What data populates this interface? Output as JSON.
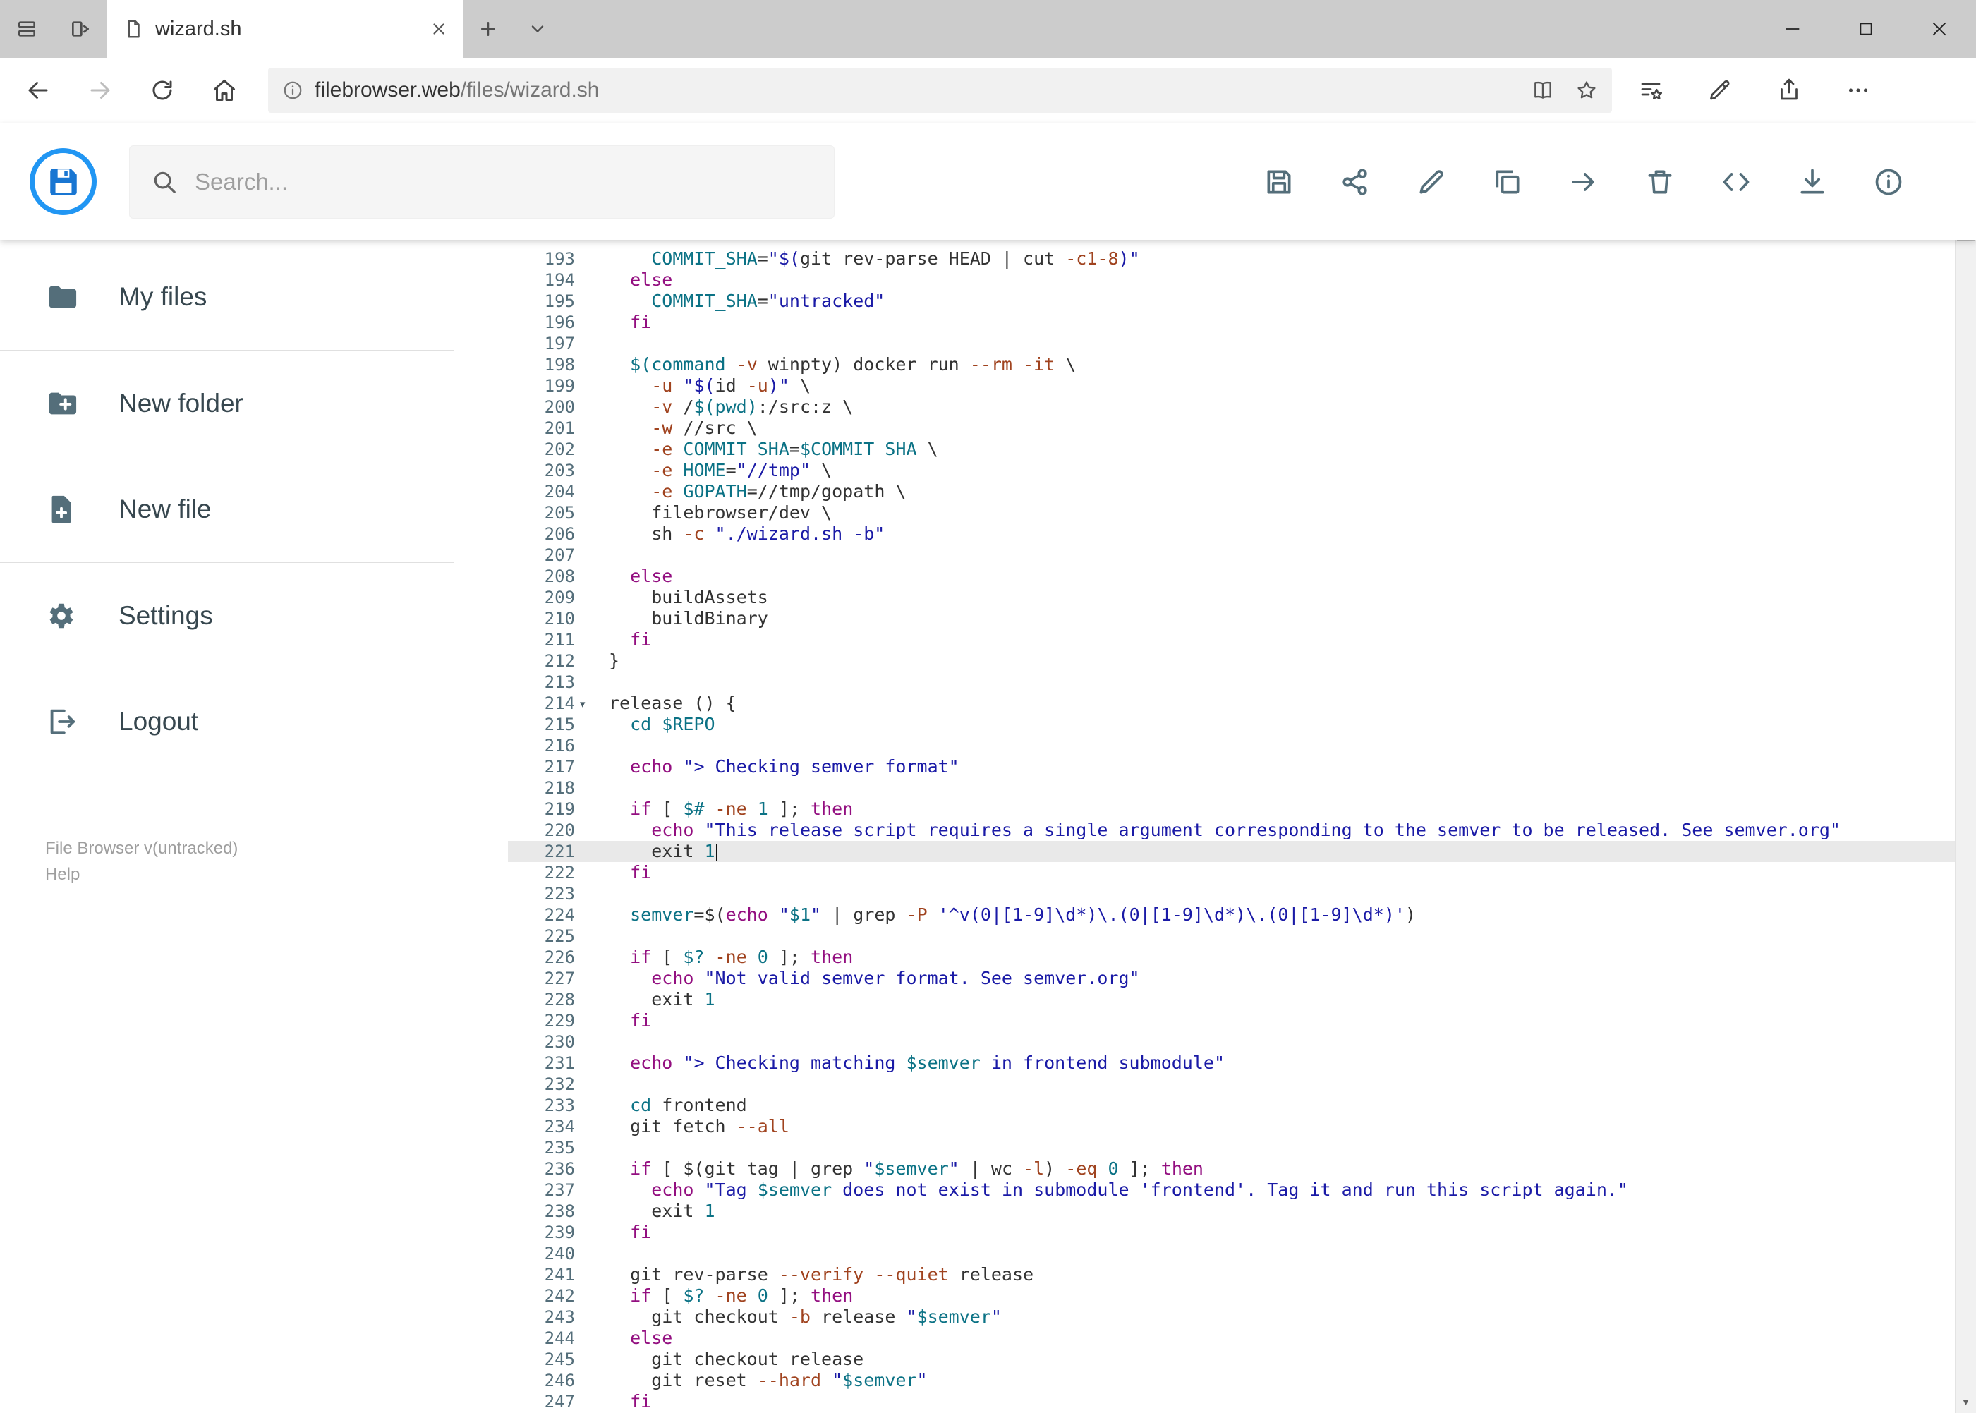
{
  "colors": {
    "accent_blue": "#2196f3",
    "toolbar_icon": "#546e7a",
    "keyword": "#930f80",
    "string": "#1a1aa6",
    "variable": "#0b7285",
    "flag": "#a0431f",
    "active_line_bg": "#e9e9e9",
    "tabstrip_bg": "#cccccc"
  },
  "browser": {
    "tab_title": "wizard.sh",
    "url_host": "filebrowser.web",
    "url_path": "/files/wizard.sh",
    "window_controls": [
      "minimize",
      "maximize",
      "close"
    ],
    "left_icons": [
      "tab-preview-icon",
      "set-tabs-aside-icon"
    ],
    "nav_icons": [
      "back",
      "forward",
      "refresh",
      "home"
    ],
    "addressbar_icons": [
      "info-circle",
      "reading-view",
      "favorite-star"
    ],
    "right_icons": [
      "favorites-hub",
      "ink-notes",
      "share",
      "more-ellipsis"
    ]
  },
  "app": {
    "search": {
      "placeholder": "Search..."
    },
    "toolbar": {
      "icons": [
        "save",
        "share",
        "rename",
        "copy",
        "move",
        "delete",
        "code-view",
        "download",
        "info"
      ]
    },
    "sidebar": {
      "items": [
        {
          "label": "My files",
          "icon": "folder-icon"
        },
        {
          "label": "New folder",
          "icon": "folder-plus-icon"
        },
        {
          "label": "New file",
          "icon": "file-plus-icon"
        },
        {
          "label": "Settings",
          "icon": "gear-icon"
        },
        {
          "label": "Logout",
          "icon": "logout-icon"
        }
      ],
      "footer": {
        "version": "File Browser v(untracked)",
        "help": "Help"
      }
    }
  },
  "editor": {
    "file": "wizard.sh",
    "active_line": 221,
    "first_line": 193,
    "last_line": 247,
    "lines": [
      {
        "n": 193,
        "t": [
          [
            "    ",
            "p"
          ],
          [
            "COMMIT_SHA",
            "v"
          ],
          [
            "=",
            "p"
          ],
          [
            "\"$(",
            "s"
          ],
          [
            "git rev-parse HEAD | cut ",
            "p"
          ],
          [
            "-c1-8",
            "f"
          ],
          [
            ")\"",
            "s"
          ]
        ]
      },
      {
        "n": 194,
        "t": [
          [
            "  ",
            "p"
          ],
          [
            "else",
            "k"
          ]
        ]
      },
      {
        "n": 195,
        "t": [
          [
            "    ",
            "p"
          ],
          [
            "COMMIT_SHA",
            "v"
          ],
          [
            "=",
            "p"
          ],
          [
            "\"untracked\"",
            "s"
          ]
        ]
      },
      {
        "n": 196,
        "t": [
          [
            "  ",
            "p"
          ],
          [
            "fi",
            "k"
          ]
        ]
      },
      {
        "n": 197,
        "t": []
      },
      {
        "n": 198,
        "t": [
          [
            "  ",
            "p"
          ],
          [
            "$(command",
            "b"
          ],
          [
            " ",
            "p"
          ],
          [
            "-v",
            "f"
          ],
          [
            " winpty) docker run ",
            "p"
          ],
          [
            "--rm",
            "f"
          ],
          [
            " ",
            "p"
          ],
          [
            "-it",
            "f"
          ],
          [
            " \\",
            "p"
          ]
        ]
      },
      {
        "n": 199,
        "t": [
          [
            "    ",
            "p"
          ],
          [
            "-u",
            "f"
          ],
          [
            " ",
            "p"
          ],
          [
            "\"$(",
            "s"
          ],
          [
            "id ",
            "p"
          ],
          [
            "-u",
            "f"
          ],
          [
            ")\"",
            "s"
          ],
          [
            " \\",
            "p"
          ]
        ]
      },
      {
        "n": 200,
        "t": [
          [
            "    ",
            "p"
          ],
          [
            "-v",
            "f"
          ],
          [
            " /",
            "p"
          ],
          [
            "$(pwd)",
            "v"
          ],
          [
            ":/src:z \\",
            "p"
          ]
        ]
      },
      {
        "n": 201,
        "t": [
          [
            "    ",
            "p"
          ],
          [
            "-w",
            "f"
          ],
          [
            " //src \\",
            "p"
          ]
        ]
      },
      {
        "n": 202,
        "t": [
          [
            "    ",
            "p"
          ],
          [
            "-e",
            "f"
          ],
          [
            " ",
            "p"
          ],
          [
            "COMMIT_SHA",
            "v"
          ],
          [
            "=",
            "p"
          ],
          [
            "$COMMIT_SHA",
            "v"
          ],
          [
            " \\",
            "p"
          ]
        ]
      },
      {
        "n": 203,
        "t": [
          [
            "    ",
            "p"
          ],
          [
            "-e",
            "f"
          ],
          [
            " ",
            "p"
          ],
          [
            "HOME",
            "v"
          ],
          [
            "=",
            "p"
          ],
          [
            "\"//tmp\"",
            "s"
          ],
          [
            " \\",
            "p"
          ]
        ]
      },
      {
        "n": 204,
        "t": [
          [
            "    ",
            "p"
          ],
          [
            "-e",
            "f"
          ],
          [
            " ",
            "p"
          ],
          [
            "GOPATH",
            "v"
          ],
          [
            "=//tmp/gopath \\",
            "p"
          ]
        ]
      },
      {
        "n": 205,
        "t": [
          [
            "    filebrowser/dev \\",
            "p"
          ]
        ]
      },
      {
        "n": 206,
        "t": [
          [
            "    sh ",
            "p"
          ],
          [
            "-c",
            "f"
          ],
          [
            " ",
            "p"
          ],
          [
            "\"./wizard.sh -b\"",
            "s"
          ]
        ]
      },
      {
        "n": 207,
        "t": []
      },
      {
        "n": 208,
        "t": [
          [
            "  ",
            "p"
          ],
          [
            "else",
            "k"
          ]
        ]
      },
      {
        "n": 209,
        "t": [
          [
            "    buildAssets",
            "p"
          ]
        ]
      },
      {
        "n": 210,
        "t": [
          [
            "    buildBinary",
            "p"
          ]
        ]
      },
      {
        "n": 211,
        "t": [
          [
            "  ",
            "p"
          ],
          [
            "fi",
            "k"
          ]
        ]
      },
      {
        "n": 212,
        "t": [
          [
            "}",
            "p"
          ]
        ]
      },
      {
        "n": 213,
        "t": []
      },
      {
        "n": 214,
        "fold": true,
        "t": [
          [
            "release () {",
            "p"
          ]
        ]
      },
      {
        "n": 215,
        "t": [
          [
            "  ",
            "p"
          ],
          [
            "cd",
            "b"
          ],
          [
            " ",
            "p"
          ],
          [
            "$REPO",
            "v"
          ]
        ]
      },
      {
        "n": 216,
        "t": []
      },
      {
        "n": 217,
        "t": [
          [
            "  ",
            "p"
          ],
          [
            "echo",
            "k"
          ],
          [
            " ",
            "p"
          ],
          [
            "\"> Checking semver format\"",
            "s"
          ]
        ]
      },
      {
        "n": 218,
        "t": []
      },
      {
        "n": 219,
        "t": [
          [
            "  ",
            "p"
          ],
          [
            "if",
            "k"
          ],
          [
            " [ ",
            "p"
          ],
          [
            "$#",
            "v"
          ],
          [
            " ",
            "p"
          ],
          [
            "-ne",
            "f"
          ],
          [
            " ",
            "p"
          ],
          [
            "1",
            "n"
          ],
          [
            " ]; ",
            "p"
          ],
          [
            "then",
            "k"
          ]
        ]
      },
      {
        "n": 220,
        "t": [
          [
            "    ",
            "p"
          ],
          [
            "echo",
            "k"
          ],
          [
            " ",
            "p"
          ],
          [
            "\"This release script requires a single argument corresponding to the semver to be released. See semver.org\"",
            "s"
          ]
        ]
      },
      {
        "n": 221,
        "cursor": true,
        "t": [
          [
            "    exit ",
            "p"
          ],
          [
            "1",
            "n"
          ]
        ]
      },
      {
        "n": 222,
        "t": [
          [
            "  ",
            "p"
          ],
          [
            "fi",
            "k"
          ]
        ]
      },
      {
        "n": 223,
        "t": []
      },
      {
        "n": 224,
        "t": [
          [
            "  ",
            "p"
          ],
          [
            "semver",
            "v"
          ],
          [
            "=$(",
            "p"
          ],
          [
            "echo",
            "k"
          ],
          [
            " ",
            "p"
          ],
          [
            "\"",
            "s"
          ],
          [
            "$1",
            "v"
          ],
          [
            "\"",
            "s"
          ],
          [
            " | grep ",
            "p"
          ],
          [
            "-P",
            "f"
          ],
          [
            " ",
            "p"
          ],
          [
            "'^v(0|[1-9]\\d*)\\.(0|[1-9]\\d*)\\.(0|[1-9]\\d*)'",
            "s"
          ],
          [
            ")",
            "p"
          ]
        ]
      },
      {
        "n": 225,
        "t": []
      },
      {
        "n": 226,
        "t": [
          [
            "  ",
            "p"
          ],
          [
            "if",
            "k"
          ],
          [
            " [ ",
            "p"
          ],
          [
            "$?",
            "v"
          ],
          [
            " ",
            "p"
          ],
          [
            "-ne",
            "f"
          ],
          [
            " ",
            "p"
          ],
          [
            "0",
            "n"
          ],
          [
            " ]; ",
            "p"
          ],
          [
            "then",
            "k"
          ]
        ]
      },
      {
        "n": 227,
        "t": [
          [
            "    ",
            "p"
          ],
          [
            "echo",
            "k"
          ],
          [
            " ",
            "p"
          ],
          [
            "\"Not valid semver format. See semver.org\"",
            "s"
          ]
        ]
      },
      {
        "n": 228,
        "t": [
          [
            "    exit ",
            "p"
          ],
          [
            "1",
            "n"
          ]
        ]
      },
      {
        "n": 229,
        "t": [
          [
            "  ",
            "p"
          ],
          [
            "fi",
            "k"
          ]
        ]
      },
      {
        "n": 230,
        "t": []
      },
      {
        "n": 231,
        "t": [
          [
            "  ",
            "p"
          ],
          [
            "echo",
            "k"
          ],
          [
            " ",
            "p"
          ],
          [
            "\"> Checking matching ",
            "s"
          ],
          [
            "$semver",
            "v"
          ],
          [
            " in frontend submodule\"",
            "s"
          ]
        ]
      },
      {
        "n": 232,
        "t": []
      },
      {
        "n": 233,
        "t": [
          [
            "  ",
            "p"
          ],
          [
            "cd",
            "b"
          ],
          [
            " frontend",
            "p"
          ]
        ]
      },
      {
        "n": 234,
        "t": [
          [
            "  git fetch ",
            "p"
          ],
          [
            "--all",
            "f"
          ]
        ]
      },
      {
        "n": 235,
        "t": []
      },
      {
        "n": 236,
        "t": [
          [
            "  ",
            "p"
          ],
          [
            "if",
            "k"
          ],
          [
            " [ $(git tag | grep ",
            "p"
          ],
          [
            "\"",
            "s"
          ],
          [
            "$semver",
            "v"
          ],
          [
            "\"",
            "s"
          ],
          [
            " | wc ",
            "p"
          ],
          [
            "-l",
            "f"
          ],
          [
            ") ",
            "p"
          ],
          [
            "-eq",
            "f"
          ],
          [
            " ",
            "p"
          ],
          [
            "0",
            "n"
          ],
          [
            " ]; ",
            "p"
          ],
          [
            "then",
            "k"
          ]
        ]
      },
      {
        "n": 237,
        "t": [
          [
            "    ",
            "p"
          ],
          [
            "echo",
            "k"
          ],
          [
            " ",
            "p"
          ],
          [
            "\"Tag ",
            "s"
          ],
          [
            "$semver",
            "v"
          ],
          [
            " does not exist in submodule 'frontend'. Tag it and run this script again.\"",
            "s"
          ]
        ]
      },
      {
        "n": 238,
        "t": [
          [
            "    exit ",
            "p"
          ],
          [
            "1",
            "n"
          ]
        ]
      },
      {
        "n": 239,
        "t": [
          [
            "  ",
            "p"
          ],
          [
            "fi",
            "k"
          ]
        ]
      },
      {
        "n": 240,
        "t": []
      },
      {
        "n": 241,
        "t": [
          [
            "  git rev-parse ",
            "p"
          ],
          [
            "--verify",
            "f"
          ],
          [
            " ",
            "p"
          ],
          [
            "--quiet",
            "f"
          ],
          [
            " release",
            "p"
          ]
        ]
      },
      {
        "n": 242,
        "t": [
          [
            "  ",
            "p"
          ],
          [
            "if",
            "k"
          ],
          [
            " [ ",
            "p"
          ],
          [
            "$?",
            "v"
          ],
          [
            " ",
            "p"
          ],
          [
            "-ne",
            "f"
          ],
          [
            " ",
            "p"
          ],
          [
            "0",
            "n"
          ],
          [
            " ]; ",
            "p"
          ],
          [
            "then",
            "k"
          ]
        ]
      },
      {
        "n": 243,
        "t": [
          [
            "    git checkout ",
            "p"
          ],
          [
            "-b",
            "f"
          ],
          [
            " release ",
            "p"
          ],
          [
            "\"",
            "s"
          ],
          [
            "$semver",
            "v"
          ],
          [
            "\"",
            "s"
          ]
        ]
      },
      {
        "n": 244,
        "t": [
          [
            "  ",
            "p"
          ],
          [
            "else",
            "k"
          ]
        ]
      },
      {
        "n": 245,
        "t": [
          [
            "    git checkout release",
            "p"
          ]
        ]
      },
      {
        "n": 246,
        "t": [
          [
            "    git reset ",
            "p"
          ],
          [
            "--hard",
            "f"
          ],
          [
            " ",
            "p"
          ],
          [
            "\"",
            "s"
          ],
          [
            "$semver",
            "v"
          ],
          [
            "\"",
            "s"
          ]
        ]
      },
      {
        "n": 247,
        "t": [
          [
            "  ",
            "p"
          ],
          [
            "fi",
            "k"
          ]
        ]
      }
    ]
  }
}
